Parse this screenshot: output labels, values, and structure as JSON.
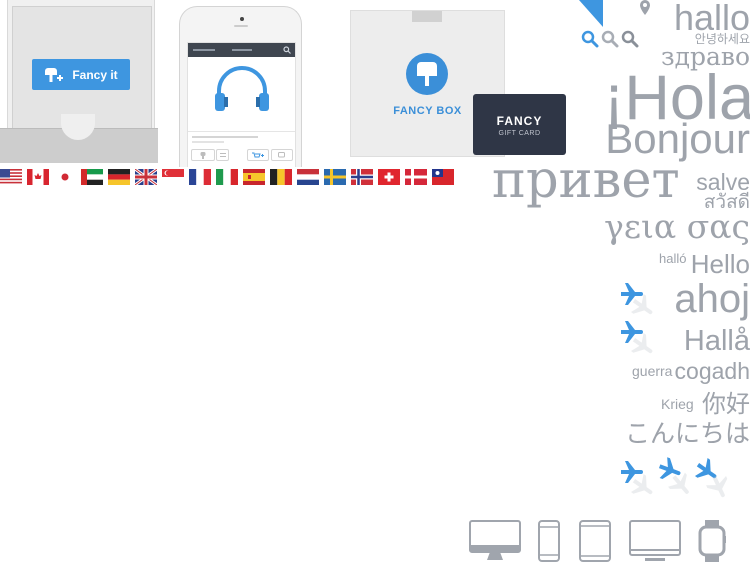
{
  "promo": {
    "fancy_it_label": "Fancy it",
    "fancy_box_label": "FANCY BOX",
    "gift_card": {
      "title": "FANCY",
      "subtitle": "GIFT CARD"
    }
  },
  "colors": {
    "brand_blue": "#3e96e0",
    "text_gray": "#9ea3ab",
    "card_dark": "#2f3646"
  },
  "flags": [
    "us",
    "ca",
    "jp",
    "ae",
    "de",
    "gb",
    "sg",
    "fr",
    "it",
    "es",
    "be",
    "nl",
    "se",
    "no",
    "ch",
    "dk",
    "tw"
  ],
  "greetings": {
    "hallo": "hallo",
    "korean": "안녕하세요",
    "zdravo": "здраво",
    "hola": "¡Hola",
    "bonjour": "Bonjour",
    "privet": "привет",
    "salve": "salve",
    "thai": "สวัสดี",
    "greek": "γεια σας",
    "hallo_hu": "halló",
    "hello": "Hello",
    "ahoj": "ahoj",
    "halla": "Hallå",
    "guerra": "guerra",
    "cogadh": "cogadh",
    "krieg": "Krieg",
    "nihao": "你好",
    "konnichiwa": "こんにちは"
  },
  "icons": {
    "search": [
      "search-icon-blue",
      "search-icon-gray",
      "search-icon-dark"
    ],
    "devices": [
      "desktop-icon",
      "phone-icon",
      "tablet-icon",
      "laptop-icon",
      "watch-icon"
    ]
  }
}
